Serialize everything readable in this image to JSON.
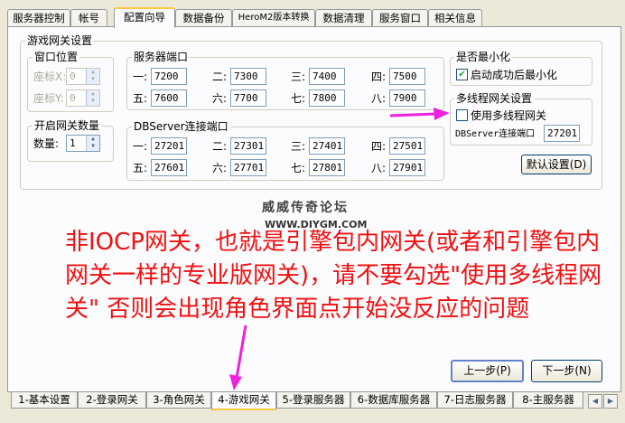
{
  "top_tabs": [
    "服务器控制",
    "帐号",
    "配置向导",
    "数据备份",
    "HeroM2版本转换",
    "数据清理",
    "服务窗口",
    "相关信息"
  ],
  "game_gateway": {
    "group_title": "游戏网关设置",
    "window_pos": {
      "title": "窗口位置",
      "x_label": "座标X:",
      "x_value": "0",
      "y_label": "座标Y:",
      "y_value": "0"
    },
    "open_count": {
      "title": "开启网关数量",
      "label": "数量:",
      "value": "1"
    },
    "server_ports": {
      "title": "服务器端口",
      "items": [
        {
          "label": "一:",
          "value": "7200"
        },
        {
          "label": "二:",
          "value": "7300"
        },
        {
          "label": "三:",
          "value": "7400"
        },
        {
          "label": "四:",
          "value": "7500"
        },
        {
          "label": "五:",
          "value": "7600"
        },
        {
          "label": "六:",
          "value": "7700"
        },
        {
          "label": "七:",
          "value": "7800"
        },
        {
          "label": "八:",
          "value": "7900"
        }
      ]
    },
    "db_ports": {
      "title": "DBServer连接端口",
      "items": [
        {
          "label": "一:",
          "value": "27201"
        },
        {
          "label": "二:",
          "value": "27301"
        },
        {
          "label": "三:",
          "value": "27401"
        },
        {
          "label": "四:",
          "value": "27501"
        },
        {
          "label": "五:",
          "value": "27601"
        },
        {
          "label": "六:",
          "value": "27701"
        },
        {
          "label": "七:",
          "value": "27801"
        },
        {
          "label": "八:",
          "value": "27901"
        }
      ]
    },
    "minimize": {
      "title": "是否最小化",
      "checkbox_label": "启动成功后最小化",
      "checked": true
    },
    "multithread": {
      "title": "多线程网关设置",
      "checkbox_label": "使用多线程网关",
      "checked": false,
      "db_port_label": "DBServer连接端口",
      "db_port_value": "27201"
    },
    "default_button": "默认设置(D)"
  },
  "watermark": {
    "line1": "威威传奇论坛",
    "line2": "WWW.DIYGM.COM"
  },
  "annotation_text": "非IOCP网关，也就是引擎包内网关(或者和引擎包内网关一样的专业版网关)，请不要勾选\"使用多线程网关\" 否则会出现角色界面点开始没反应的问题",
  "colors": {
    "annotation": "#f01010",
    "arrow": "#ee22dd"
  },
  "buttons": {
    "prev": "上一步(P)",
    "next": "下一步(N)"
  },
  "bottom_tabs": [
    "1-基本设置",
    "2-登录网关",
    "3-角色网关",
    "4-游戏网关",
    "5-登录服务器",
    "6-数据库服务器",
    "7-日志服务器",
    "8-主服务器"
  ],
  "scroll_icons": [
    "left-arrow-icon",
    "right-arrow-icon"
  ]
}
